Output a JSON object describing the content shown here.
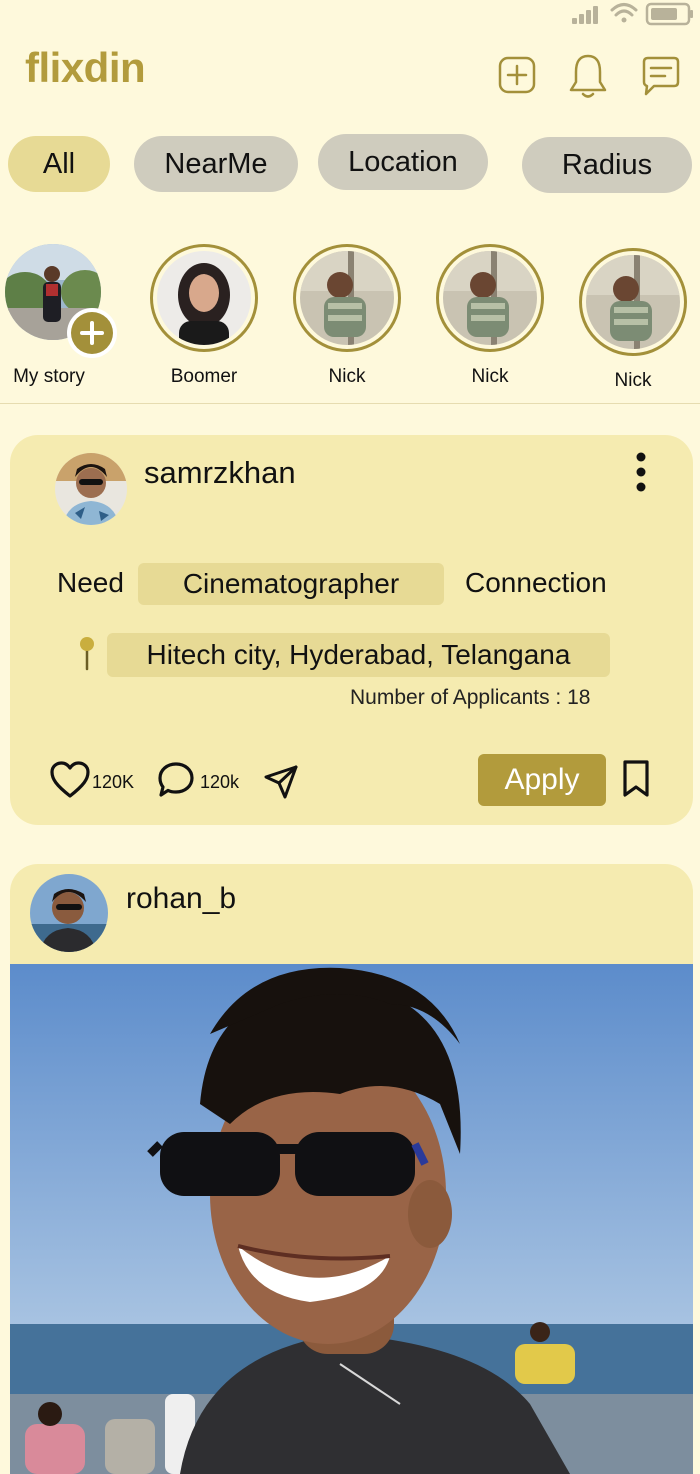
{
  "app": {
    "logo": "flixdin"
  },
  "header": {
    "icons": [
      "add-square-icon",
      "bell-icon",
      "chat-icon"
    ]
  },
  "filters": [
    {
      "label": "All",
      "active": true
    },
    {
      "label": "NearMe",
      "active": false
    },
    {
      "label": "Location",
      "active": false
    },
    {
      "label": "Radius",
      "active": false
    }
  ],
  "stories": [
    {
      "label": "My story"
    },
    {
      "label": "Boomer"
    },
    {
      "label": "Nick"
    },
    {
      "label": "Nick"
    },
    {
      "label": "Nick"
    }
  ],
  "posts": [
    {
      "username": "samrzkhan",
      "need_label": "Need",
      "role": "Cinematographer",
      "connection_label": "Connection",
      "location": "Hitech city, Hyderabad, Telangana",
      "applicants": "Number of Applicants : 18",
      "likes": "120K",
      "comments": "120k",
      "apply_label": "Apply"
    },
    {
      "username": "rohan_b"
    }
  ],
  "colors": {
    "background": "#FEF9DC",
    "accent": "#B29B3C",
    "chip_active": "#E7DA95",
    "chip_idle": "#CFCCBE",
    "card": "#F5EBB0"
  }
}
